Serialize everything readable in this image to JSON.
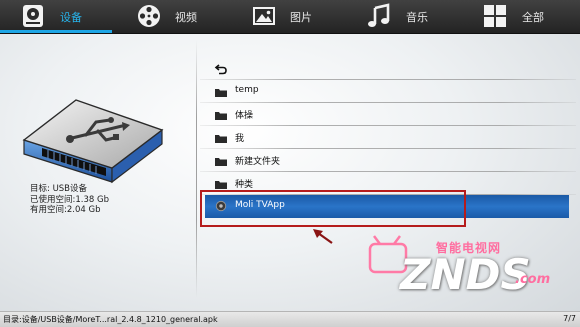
{
  "tabs": [
    {
      "label": "设备",
      "icon": "hard-drive-icon",
      "active": true
    },
    {
      "label": "视频",
      "icon": "film-reel-icon",
      "active": false
    },
    {
      "label": "图片",
      "icon": "picture-icon",
      "active": false
    },
    {
      "label": "音乐",
      "icon": "music-note-icon",
      "active": false
    },
    {
      "label": "全部",
      "icon": "grid-icon",
      "active": false
    }
  ],
  "device": {
    "icon": "usb-drive-icon",
    "name": "目标: USB设备",
    "used": "已使用空间:1.38 Gb",
    "free": "有用空间:2.04 Gb"
  },
  "files": [
    {
      "name": "",
      "icon": "back-arrow-icon"
    },
    {
      "name": "temp",
      "icon": "folder-icon"
    },
    {
      "name": "体操",
      "icon": "folder-icon"
    },
    {
      "name": "我",
      "icon": "folder-icon"
    },
    {
      "name": "新建文件夹",
      "icon": "folder-icon"
    },
    {
      "name": "种类",
      "icon": "folder-icon"
    }
  ],
  "selected_file": {
    "name": "Moli TVApp",
    "icon": "app-file-icon"
  },
  "watermark": {
    "sub": "智能电视网",
    "main": "ZNDS",
    "suffix": ".com"
  },
  "status": {
    "path": "目录:设备/USB设备/MoreT...ral_2.4.8_1210_general.apk",
    "page": "7/7"
  },
  "colors": {
    "accent": "#1ea6e6",
    "selection": "#2a74c8",
    "highlight_box": "#b51c1c"
  }
}
